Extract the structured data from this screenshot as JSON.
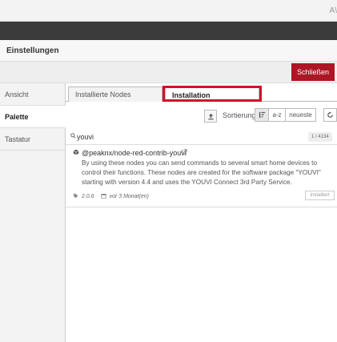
{
  "top_bar": {
    "corner_text": "A\\"
  },
  "dialog": {
    "title": "Einstellungen",
    "close_label": "Schließen"
  },
  "sidebar": {
    "items": [
      {
        "label": "Ansicht"
      },
      {
        "label": "Palette"
      },
      {
        "label": "Tastatur"
      }
    ]
  },
  "tabs": [
    {
      "label": "Installierte Nodes"
    },
    {
      "label": "Installation"
    }
  ],
  "sort": {
    "label": "Sortierung:",
    "options": [
      "a-z",
      "neueste"
    ]
  },
  "search": {
    "value": "youvi",
    "count": "1 / 4134"
  },
  "result": {
    "name": "@peaknx/node-red-contrib-youvi",
    "description": "By using these nodes you can send commands to several smart home devices to control their functions. These nodes are created for the software package \"YOUVI\" starting with version 4.4 and uses the YOUVI Connect 3rd Party Service.",
    "version": "2.0.6",
    "date": "vor 3 Monat(en)",
    "status_label": "installiert"
  },
  "colors": {
    "accent_red": "#ad1625",
    "highlight_red": "#d0112b",
    "header_dark": "#3b3b3b"
  }
}
